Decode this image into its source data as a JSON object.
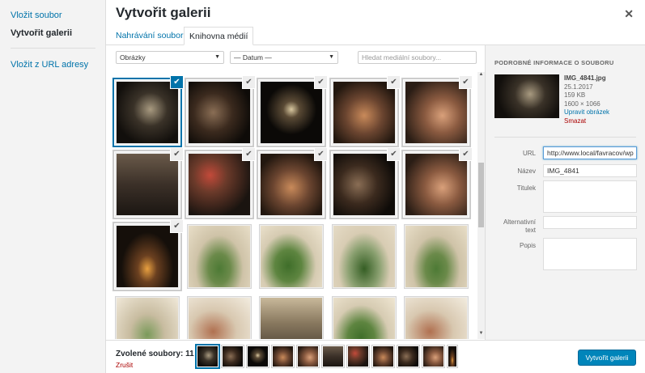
{
  "sidebar": {
    "items": [
      {
        "label": "Vložit soubor"
      },
      {
        "label": "Vytvořit galerii"
      },
      {
        "label": "Vložit z URL adresy"
      }
    ]
  },
  "modal": {
    "title": "Vytvořit galerii",
    "close_icon": "close-icon"
  },
  "tabs": [
    {
      "label": "Nahrávání souborů"
    },
    {
      "label": "Knihovna médií"
    }
  ],
  "filters": {
    "type_selected": "Obrázky",
    "date_selected": "— Datum —",
    "search_placeholder": "Hledat mediální soubory..."
  },
  "details": {
    "heading": "PODROBNÉ INFORMACE O SOUBORU",
    "filename": "IMG_4841.jpg",
    "date": "25.1.2017",
    "size": "159 KB",
    "dimensions": "1600 × 1066",
    "edit_link": "Upravit obrázek",
    "delete_link": "Smazat",
    "fields": {
      "url_label": "URL",
      "url_value": "http://www.local/favracov/wp",
      "name_label": "Název",
      "name_value": "IMG_4841",
      "caption_label": "Titulek",
      "alt_label_line1": "Alternativní",
      "alt_label_line2": "text",
      "description_label": "Popis"
    }
  },
  "footer": {
    "selected_count": "Zvolené soubory: 11",
    "clear_label": "Zrušit",
    "create_button": "Vytvořit galerii"
  },
  "selection": {
    "selected_items": 11
  },
  "colors": {
    "accent": "#0073aa",
    "button": "#0085ba",
    "danger": "#a00"
  }
}
